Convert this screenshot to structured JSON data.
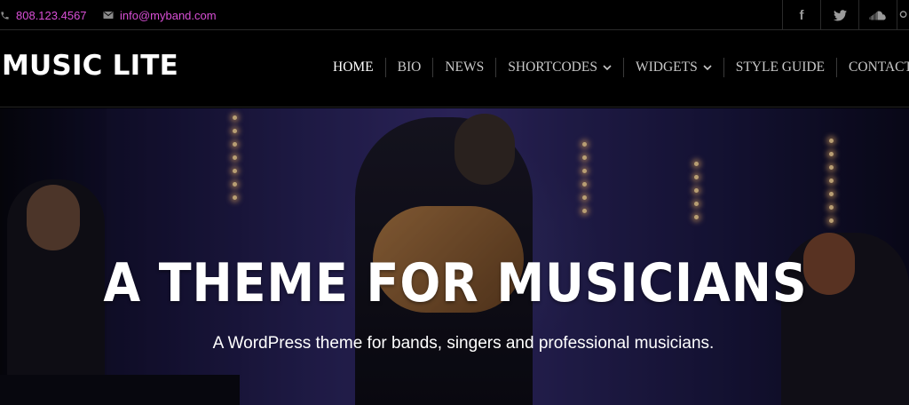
{
  "topbar": {
    "phone": "808.123.4567",
    "email": "info@myband.com",
    "phone_icon": "phone-icon",
    "email_icon": "envelope-icon",
    "socials": [
      {
        "icon": "facebook-icon",
        "glyph": "f"
      },
      {
        "icon": "twitter-icon",
        "glyph": ""
      },
      {
        "icon": "soundcloud-icon",
        "glyph": ""
      },
      {
        "icon": "search-icon",
        "glyph": ""
      }
    ]
  },
  "header": {
    "logo": "MUSIC LITE",
    "nav": [
      {
        "label": "HOME",
        "active": true,
        "dropdown": false
      },
      {
        "label": "BIO",
        "active": false,
        "dropdown": false
      },
      {
        "label": "NEWS",
        "active": false,
        "dropdown": false
      },
      {
        "label": "SHORTCODES",
        "active": false,
        "dropdown": true
      },
      {
        "label": "WIDGETS",
        "active": false,
        "dropdown": true
      },
      {
        "label": "STYLE GUIDE",
        "active": false,
        "dropdown": false
      },
      {
        "label": "CONTACT",
        "active": false,
        "dropdown": false
      }
    ]
  },
  "hero": {
    "title": "A THEME FOR MUSICIANS",
    "subtitle": "A WordPress theme for bands, singers and professional musicians."
  },
  "colors": {
    "accent": "#d94fd6",
    "background": "#000000",
    "hero_tint": "#3a3078"
  }
}
